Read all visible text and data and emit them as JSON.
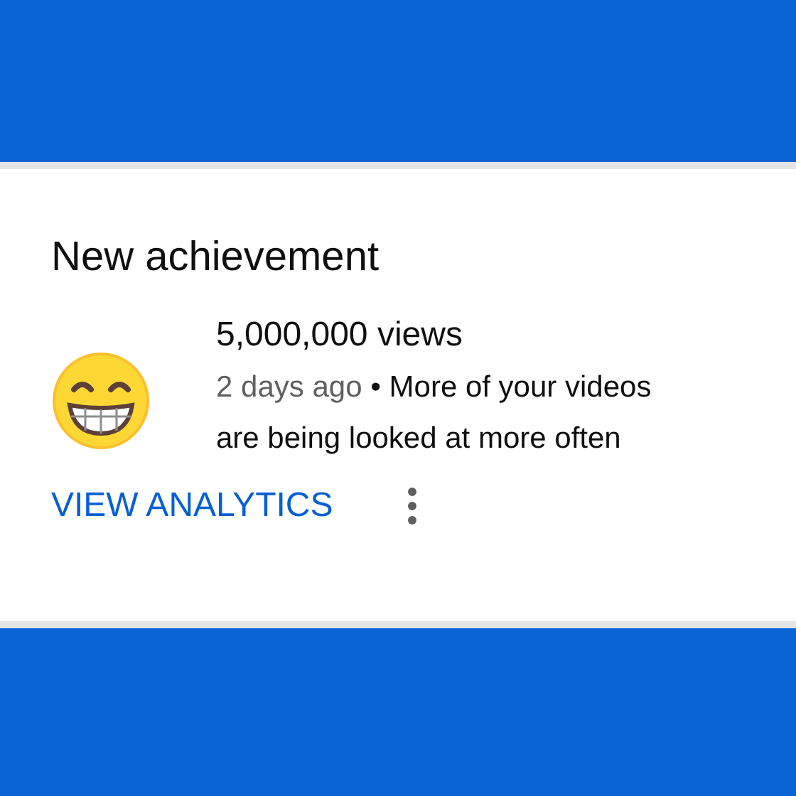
{
  "notification": {
    "title": "New achievement",
    "headline": "5,000,000 views",
    "time": "2 days ago",
    "message": "• More of your videos are being looked at more often",
    "action": "VIEW ANALYTICS"
  }
}
